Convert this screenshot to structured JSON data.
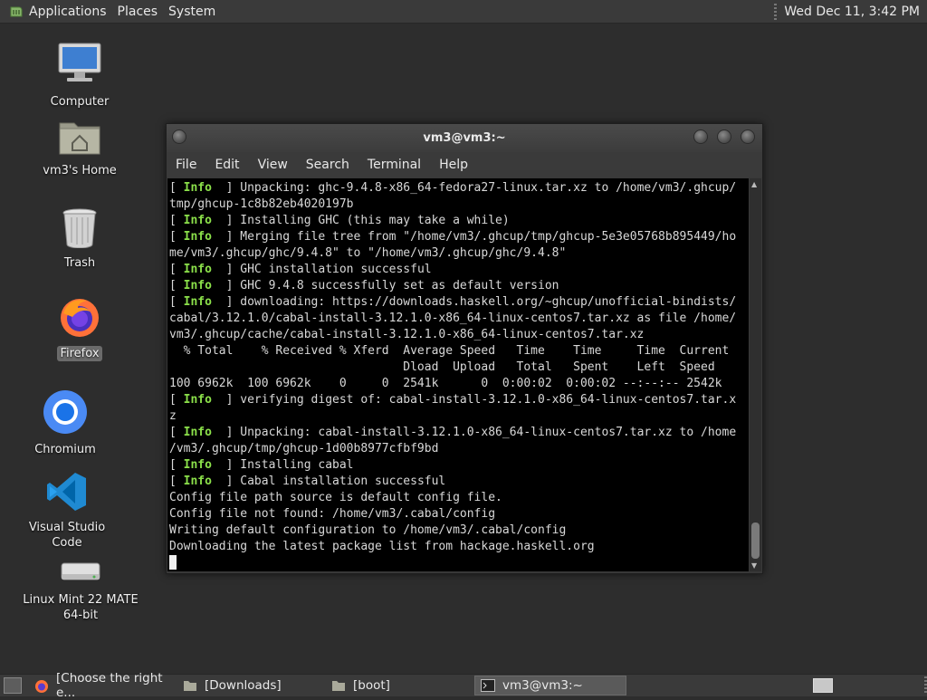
{
  "top_panel": {
    "menus": [
      "Applications",
      "Places",
      "System"
    ],
    "clock": "Wed Dec 11,  3:42 PM"
  },
  "desktop": {
    "icons": [
      {
        "label": "Computer",
        "icon": "computer-icon"
      },
      {
        "label": "vm3's Home",
        "icon": "home-folder-icon"
      },
      {
        "label": "Trash",
        "icon": "trash-icon"
      },
      {
        "label": "Firefox",
        "icon": "firefox-icon",
        "selected": true
      },
      {
        "label": "Chromium",
        "icon": "chromium-icon"
      },
      {
        "label": "Visual Studio Code",
        "icon": "vscode-icon"
      },
      {
        "label": "Linux Mint 22 MATE\n64-bit",
        "icon": "drive-icon"
      }
    ]
  },
  "window": {
    "title": "vm3@vm3:~",
    "menus": [
      "File",
      "Edit",
      "View",
      "Search",
      "Terminal",
      "Help"
    ]
  },
  "terminal": {
    "lines": [
      {
        "info": true,
        "text": "Unpacking: ghc-9.4.8-x86_64-fedora27-linux.tar.xz to /home/vm3/.ghcup/"
      },
      {
        "info": false,
        "text": "tmp/ghcup-1c8b82eb4020197b"
      },
      {
        "info": true,
        "text": "Installing GHC (this may take a while)"
      },
      {
        "info": true,
        "text": "Merging file tree from \"/home/vm3/.ghcup/tmp/ghcup-5e3e05768b895449/ho"
      },
      {
        "info": false,
        "text": "me/vm3/.ghcup/ghc/9.4.8\" to \"/home/vm3/.ghcup/ghc/9.4.8\""
      },
      {
        "info": true,
        "text": "GHC installation successful"
      },
      {
        "info": true,
        "text": "GHC 9.4.8 successfully set as default version"
      },
      {
        "info": true,
        "text": "downloading: https://downloads.haskell.org/~ghcup/unofficial-bindists/"
      },
      {
        "info": false,
        "text": "cabal/3.12.1.0/cabal-install-3.12.1.0-x86_64-linux-centos7.tar.xz as file /home/"
      },
      {
        "info": false,
        "text": "vm3/.ghcup/cache/cabal-install-3.12.1.0-x86_64-linux-centos7.tar.xz"
      },
      {
        "info": false,
        "text": "  % Total    % Received % Xferd  Average Speed   Time    Time     Time  Current"
      },
      {
        "info": false,
        "text": "                                 Dload  Upload   Total   Spent    Left  Speed"
      },
      {
        "info": false,
        "text": "100 6962k  100 6962k    0     0  2541k      0  0:00:02  0:00:02 --:--:-- 2542k"
      },
      {
        "info": true,
        "text": "verifying digest of: cabal-install-3.12.1.0-x86_64-linux-centos7.tar.x"
      },
      {
        "info": false,
        "text": "z"
      },
      {
        "info": true,
        "text": "Unpacking: cabal-install-3.12.1.0-x86_64-linux-centos7.tar.xz to /home"
      },
      {
        "info": false,
        "text": "/vm3/.ghcup/tmp/ghcup-1d00b8977cfbf9bd"
      },
      {
        "info": true,
        "text": "Installing cabal"
      },
      {
        "info": true,
        "text": "Cabal installation successful"
      },
      {
        "info": false,
        "text": "Config file path source is default config file."
      },
      {
        "info": false,
        "text": "Config file not found: /home/vm3/.cabal/config"
      },
      {
        "info": false,
        "text": "Writing default configuration to /home/vm3/.cabal/config"
      },
      {
        "info": false,
        "text": "Downloading the latest package list from hackage.haskell.org"
      }
    ],
    "info_prefix_open": "[ ",
    "info_word": "Info",
    "info_prefix_close": "  ] "
  },
  "taskbar": {
    "tasks": [
      {
        "label": "[Choose the right e...",
        "icon": "firefox-icon",
        "active": false
      },
      {
        "label": "[Downloads]",
        "icon": "folder-icon",
        "active": false
      },
      {
        "label": "[boot]",
        "icon": "folder-icon",
        "active": false
      },
      {
        "label": "vm3@vm3:~",
        "icon": "terminal-icon",
        "active": true
      }
    ]
  },
  "colors": {
    "info_green": "#8be04a",
    "desktop_bg": "#2d2d2d",
    "terminal_bg": "#000000"
  }
}
